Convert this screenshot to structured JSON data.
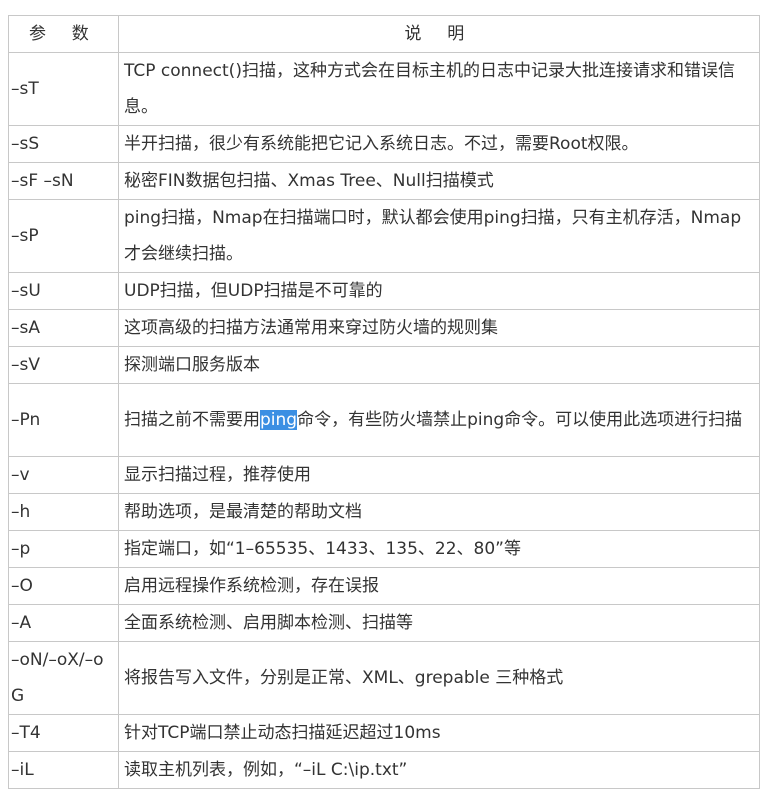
{
  "header": {
    "param": "参 数",
    "desc": "说 明"
  },
  "rows": [
    {
      "param": "–sT",
      "desc": " TCP connect()扫描，这种方式会在目标主机的日志中记录大批连接请求和错误信息。"
    },
    {
      "param": "–sS",
      "desc": "半开扫描，很少有系统能把它记入系统日志。不过，需要Root权限。"
    },
    {
      "param": "–sF –sN",
      "desc": "秘密FIN数据包扫描、Xmas Tree、Null扫描模式"
    },
    {
      "param": "–sP",
      "desc": " ping扫描，Nmap在扫描端口时，默认都会使用ping扫描，只有主机存活，Nmap才会继续扫描。"
    },
    {
      "param": "–sU",
      "desc": "UDP扫描，但UDP扫描是不可靠的"
    },
    {
      "param": "–sA",
      "desc": "这项高级的扫描方法通常用来穿过防火墙的规则集"
    },
    {
      "param": "–sV",
      "desc": "探测端口服务版本"
    },
    {
      "param": "–Pn",
      "desc_before": " 扫描之前不需要用",
      "desc_highlight": "ping",
      "desc_after": "命令，有些防火墙禁止ping命令。可以使用此选项进行扫描"
    },
    {
      "param": "–v",
      "desc": "显示扫描过程，推荐使用"
    },
    {
      "param": "–h",
      "desc": "帮助选项，是最清楚的帮助文档"
    },
    {
      "param": "–p",
      "desc": "指定端口，如“1–65535、1433、135、22、80”等"
    },
    {
      "param": "–O",
      "desc": "启用远程操作系统检测，存在误报"
    },
    {
      "param": "–A",
      "desc": "全面系统检测、启用脚本检测、扫描等"
    },
    {
      "param": "–oN/–oX/–oG",
      "desc": "将报告写入文件，分别是正常、XML、grepable 三种格式"
    },
    {
      "param": "–T4",
      "desc": "针对TCP端口禁止动态扫描延迟超过10ms"
    },
    {
      "param": "–iL",
      "desc": "读取主机列表，例如，“–iL C:\\ip.txt”"
    }
  ]
}
